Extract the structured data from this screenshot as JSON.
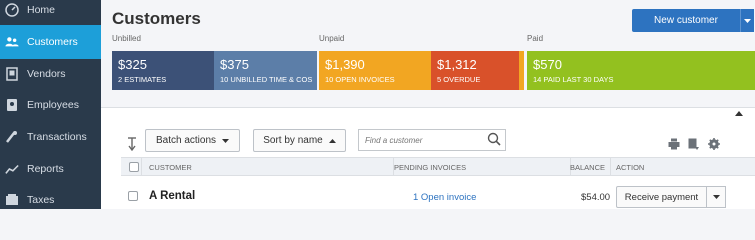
{
  "sidebar": {
    "items": [
      {
        "label": "Home",
        "icon": "dashboard-icon"
      },
      {
        "label": "Customers",
        "icon": "customers-icon",
        "active": true
      },
      {
        "label": "Vendors",
        "icon": "vendors-icon"
      },
      {
        "label": "Employees",
        "icon": "employees-icon"
      },
      {
        "label": "Transactions",
        "icon": "transactions-icon"
      },
      {
        "label": "Reports",
        "icon": "reports-icon"
      },
      {
        "label": "Taxes",
        "icon": "taxes-icon"
      }
    ]
  },
  "header": {
    "title": "Customers",
    "new_button": "New customer"
  },
  "summary": {
    "unbilled_label": "Unbilled",
    "unpaid_label": "Unpaid",
    "paid_label": "Paid",
    "tiles": [
      {
        "amount": "$325",
        "caption": "2 ESTIMATES",
        "color": "#3c5177"
      },
      {
        "amount": "$375",
        "caption": "10 UNBILLED TIME & COS",
        "color": "#5c7ea8"
      },
      {
        "amount": "$1,390",
        "caption": "10 OPEN INVOICES",
        "color": "#f2a622"
      },
      {
        "amount": "$1,312",
        "caption": "5 OVERDUE",
        "color": "#d9512a"
      },
      {
        "amount": "$570",
        "caption": "14 PAID LAST 30 DAYS",
        "color": "#93c11f"
      }
    ]
  },
  "toolbar": {
    "batch_actions": "Batch actions",
    "sort_by": "Sort by name",
    "search_placeholder": "Find a customer"
  },
  "table": {
    "columns": [
      "CUSTOMER",
      "PENDING INVOICES",
      "BALANCE",
      "ACTION"
    ],
    "rows": [
      {
        "customer": "A Rental",
        "pending": "1 Open invoice",
        "balance": "$54.00",
        "action": "Receive payment"
      }
    ]
  },
  "colors": {
    "sidebar_bg": "#2a3a4b",
    "sidebar_active": "#1d9fd9",
    "primary": "#2d73c0"
  }
}
